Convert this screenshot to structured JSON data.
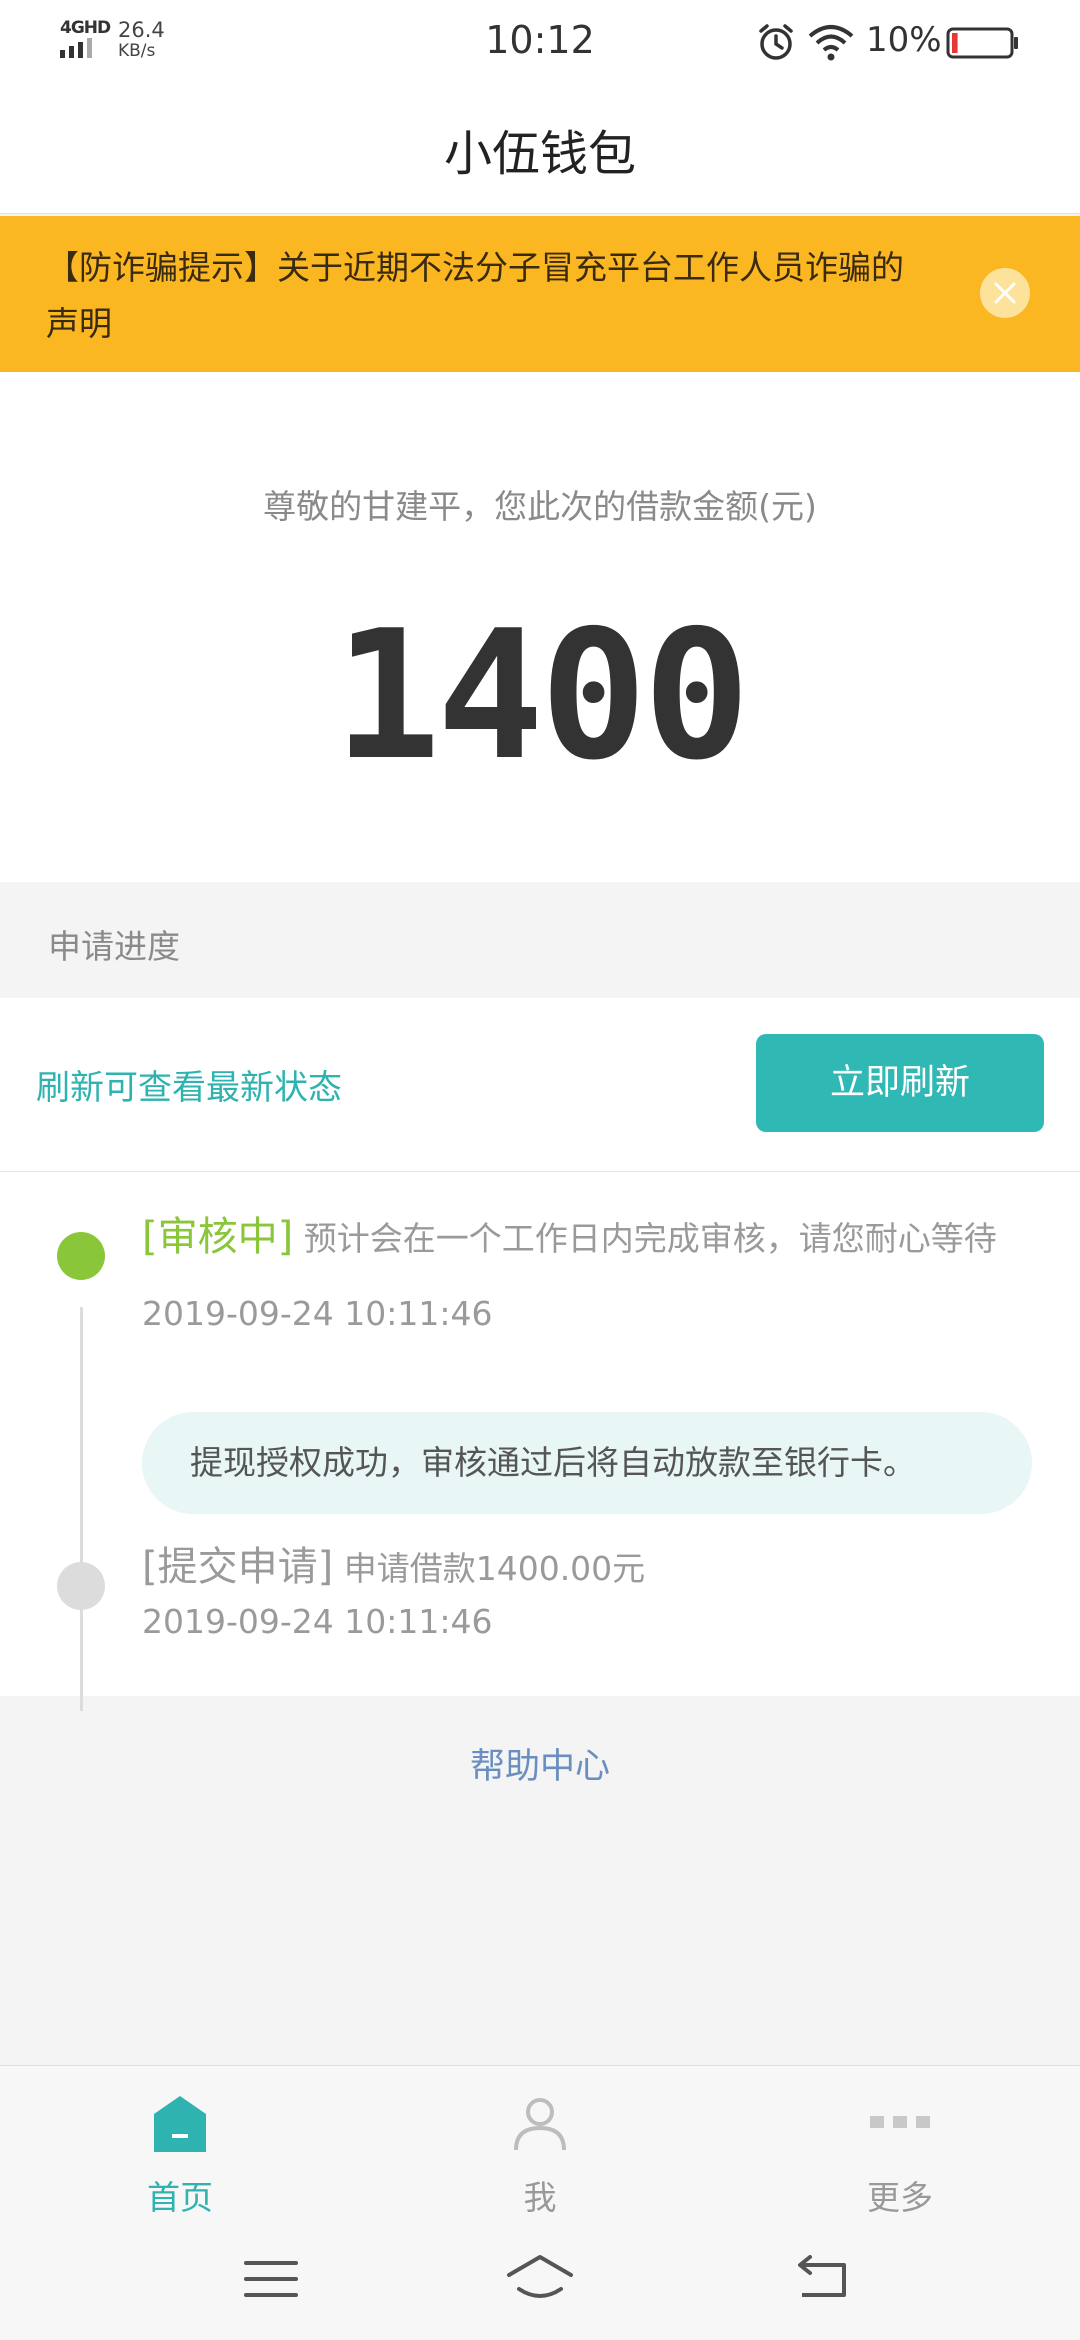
{
  "status_bar": {
    "network": "4GHD",
    "speed": "26.4",
    "speed_unit": "KB/s",
    "time": "10:12",
    "battery_percent": "10%",
    "battery_level": 0.1,
    "icons": [
      "signal-icon",
      "alarm-icon",
      "wifi-icon",
      "battery-icon"
    ]
  },
  "header": {
    "title": "小伍钱包"
  },
  "notice": {
    "text": "【防诈骗提示】关于近期不法分子冒充平台工作人员诈骗的声明",
    "close_icon": "close-icon",
    "bg_color": "#fbb722"
  },
  "amount": {
    "label": "尊敬的甘建平，您此次的借款金额(元)",
    "value": "1400"
  },
  "progress": {
    "section_title": "申请进度",
    "refresh_hint": "刷新可查看最新状态",
    "refresh_button": "立即刷新",
    "accent_color": "#2fb8b4",
    "steps": [
      {
        "tag": "[审核中]",
        "desc": " 预计会在一个工作日内完成审核，请您耐心等待",
        "time": "2019-09-24 10:11:46",
        "note": "提现授权成功，审核通过后将自动放款至银行卡。",
        "status_color": "#8ac63a"
      },
      {
        "tag": "[提交申请]",
        "desc": " 申请借款1400.00元",
        "time": "2019-09-24 10:11:46",
        "status_color": "#dcdcdc"
      }
    ]
  },
  "help": {
    "label": "帮助中心"
  },
  "tabs": [
    {
      "label": "首页",
      "icon": "home-icon",
      "active": true
    },
    {
      "label": "我",
      "icon": "user-icon",
      "active": false
    },
    {
      "label": "更多",
      "icon": "more-icon",
      "active": false
    }
  ],
  "system_nav": [
    "menu-icon",
    "home-nav-icon",
    "back-icon"
  ]
}
